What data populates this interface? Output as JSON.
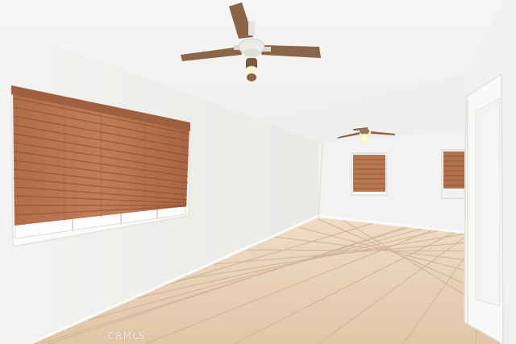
{
  "watermark": {
    "text": "CRMLS"
  },
  "colors": {
    "wall_left": "#f1f1ef",
    "wall_back": "#f4f4f2",
    "ceiling": "#f7f7f6",
    "floor_tile": "#e6ccb0",
    "grout": "#cdb294",
    "blind_wood": "#b5734f",
    "blind_wood_dark": "#8d5236",
    "fan_blade": "#8a6547",
    "door_trim": "#f8f8f6"
  },
  "icons": {
    "ceiling_fan_near": "ceiling-fan-icon",
    "ceiling_fan_far": "ceiling-fan-icon"
  }
}
